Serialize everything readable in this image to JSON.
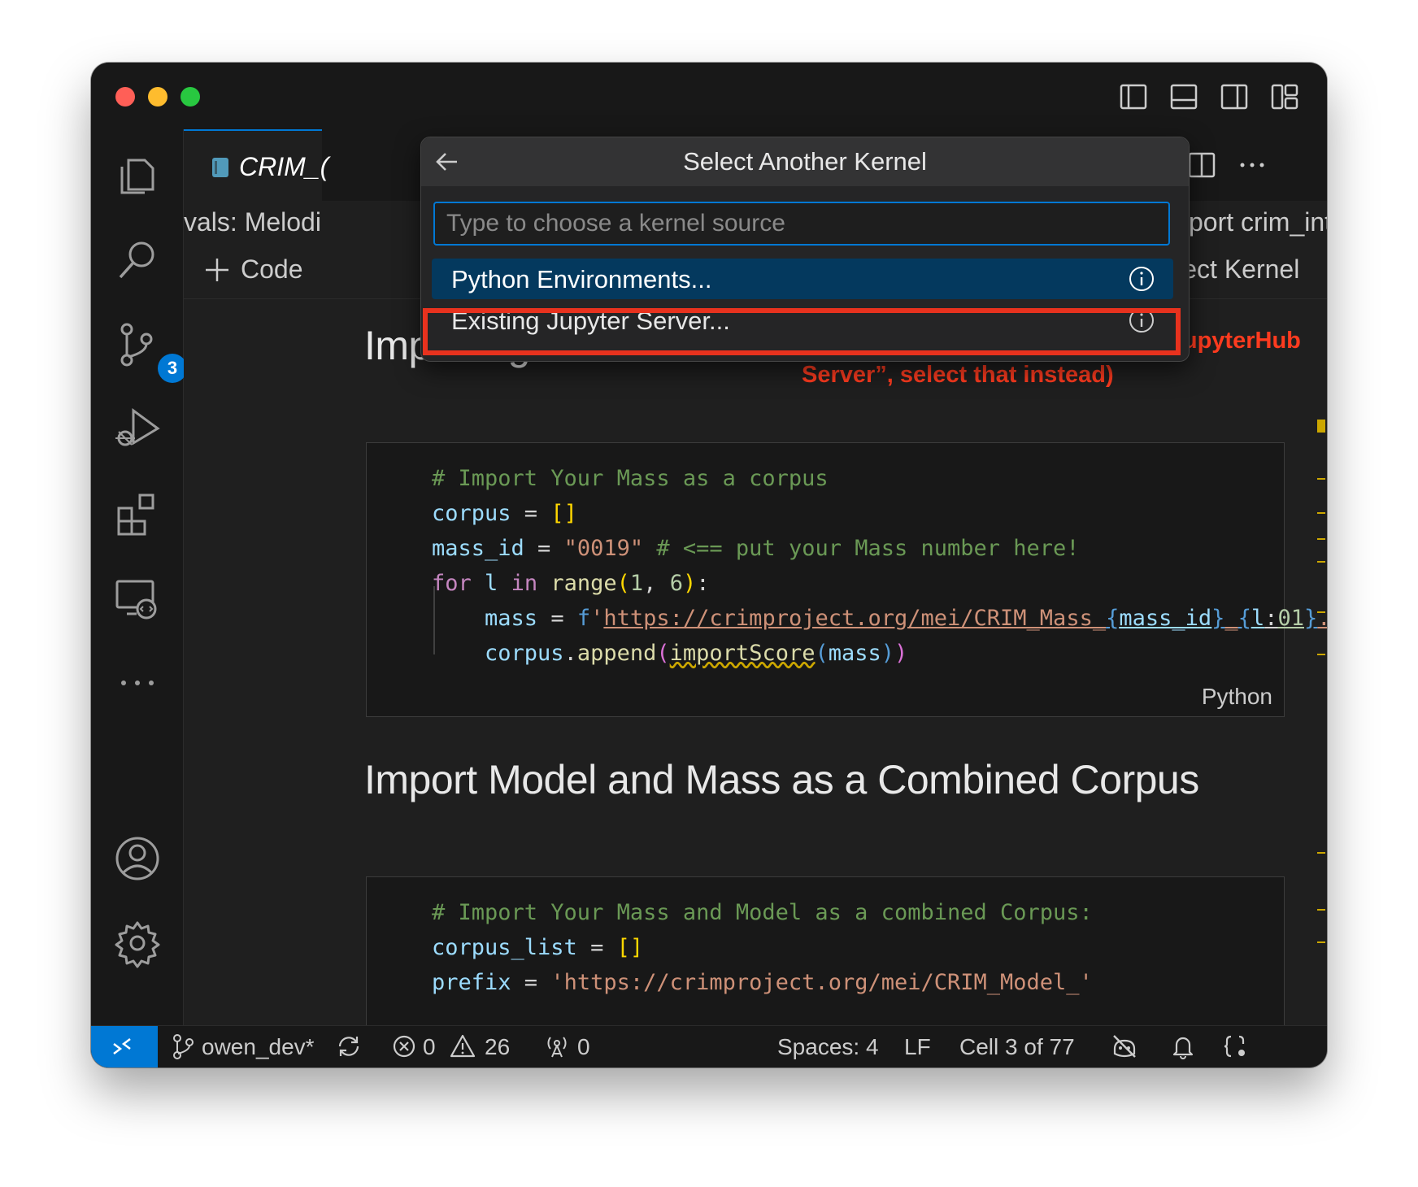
{
  "quick_pick": {
    "title": "Select Another Kernel",
    "placeholder": "Type to choose a kernel source",
    "items": [
      {
        "label": "Python Environments..."
      },
      {
        "label": "Existing Jupyter Server..."
      }
    ]
  },
  "tab": {
    "label": "CRIM_("
  },
  "breadcrumb": {
    "left": "vals:  Melodi",
    "right": "port crim_intervals"
  },
  "toolbar": {
    "add_code_label": "Code",
    "select_kernel_label": "Select Kernel"
  },
  "activity_bar": {
    "source_control_badge": "3"
  },
  "notebook": {
    "heading1": "Importing One Full Mass",
    "annotation": "(if you have the option “Existing JupyterHub Server”, select that instead)",
    "heading2": "Import Model and Mass as a Combined Corpus",
    "cell1_language": "Python"
  },
  "statusbar": {
    "branch": "owen_dev*",
    "errors": "0",
    "warnings": "26",
    "ports": "0",
    "spaces": "Spaces: 4",
    "eol": "LF",
    "cell": "Cell 3 of 77"
  },
  "colors": {
    "accent": "#0078d4",
    "annotation_red": "#ff3b1f",
    "highlight_box": "#e8321e"
  },
  "icons": [
    "explorer-icon",
    "search-icon",
    "source-control-icon",
    "run-debug-icon",
    "extensions-icon",
    "remote-explorer-icon",
    "account-icon",
    "settings-gear-icon",
    "back-arrow-icon",
    "info-icon",
    "kernel-icon"
  ]
}
